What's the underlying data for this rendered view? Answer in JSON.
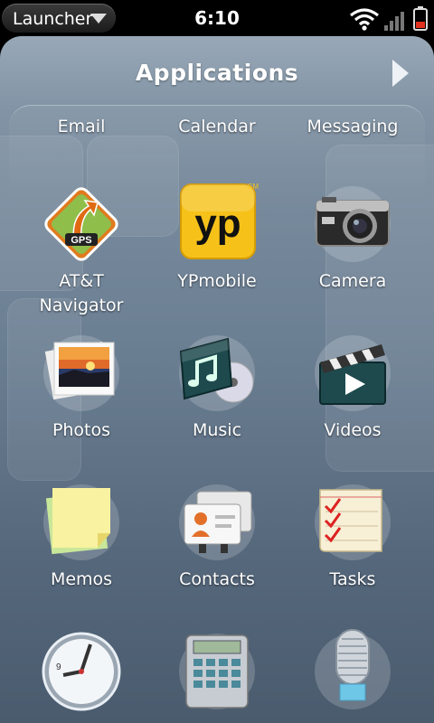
{
  "status_bar": {
    "launcher_label": "Launcher",
    "time": "6:10"
  },
  "panel": {
    "title": "Applications"
  },
  "top_row": [
    {
      "label": "Email"
    },
    {
      "label": "Calendar"
    },
    {
      "label": "Messaging"
    }
  ],
  "apps": [
    {
      "label": "AT&T Navigator",
      "icon": "gps-navigator-icon"
    },
    {
      "label": "YPmobile",
      "icon": "yp-icon"
    },
    {
      "label": "Camera",
      "icon": "camera-icon"
    },
    {
      "label": "Photos",
      "icon": "photos-icon"
    },
    {
      "label": "Music",
      "icon": "music-icon"
    },
    {
      "label": "Videos",
      "icon": "clapperboard-icon"
    },
    {
      "label": "Memos",
      "icon": "sticky-note-icon"
    },
    {
      "label": "Contacts",
      "icon": "contacts-cards-icon"
    },
    {
      "label": "Tasks",
      "icon": "task-list-icon"
    },
    {
      "label": "",
      "icon": "clock-icon"
    },
    {
      "label": "",
      "icon": "calculator-icon"
    },
    {
      "label": "",
      "icon": "microphone-icon"
    }
  ],
  "icon_text": {
    "gps": "GPS",
    "yp": "yp",
    "yp_mark": "SM",
    "clock_numeral": "9"
  },
  "colors": {
    "panel_top": "#8a9cad",
    "panel_bottom": "#4a5b6e",
    "yp_yellow": "#f6c21a",
    "battery_red": "#e0301e"
  }
}
